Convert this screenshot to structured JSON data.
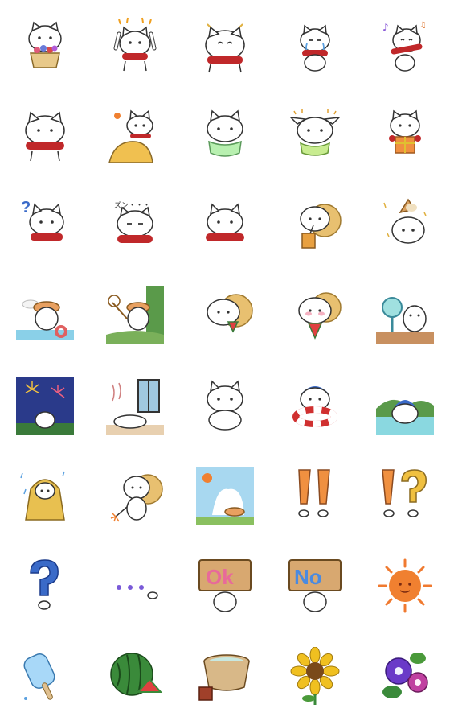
{
  "sheet": {
    "columns": 5,
    "rows": 8,
    "stickers": [
      {
        "name": "cat-flower-basket-icon"
      },
      {
        "name": "cat-cheer-icon"
      },
      {
        "name": "cat-happy-sparkle-icon"
      },
      {
        "name": "cat-tears-icon"
      },
      {
        "name": "cat-singing-icon"
      },
      {
        "name": "cat-scarf-icon"
      },
      {
        "name": "cat-on-rock-icon"
      },
      {
        "name": "cat-green-collar-icon"
      },
      {
        "name": "cat-sparkle-ears-icon"
      },
      {
        "name": "cat-gift-icon"
      },
      {
        "name": "cat-question-icon",
        "text": "?"
      },
      {
        "name": "cat-sulking-icon",
        "text": "ズン・・・"
      },
      {
        "name": "cat-scarf-2-icon"
      },
      {
        "name": "cat-drink-icon"
      },
      {
        "name": "cat-ice-cream-icon"
      },
      {
        "name": "cat-beach-hat-icon"
      },
      {
        "name": "cat-bug-net-icon"
      },
      {
        "name": "cat-watermelon-hat-icon"
      },
      {
        "name": "cat-watermelon-icon"
      },
      {
        "name": "cat-fan-icon"
      },
      {
        "name": "cat-fireworks-icon"
      },
      {
        "name": "cat-window-heat-icon"
      },
      {
        "name": "cat-sitting-icon"
      },
      {
        "name": "cat-swim-ring-icon"
      },
      {
        "name": "cat-onsen-icon"
      },
      {
        "name": "cat-raincoat-icon"
      },
      {
        "name": "cat-sparkler-icon"
      },
      {
        "name": "summer-sky-icon"
      },
      {
        "name": "exclamation-double-icon",
        "text": "!!"
      },
      {
        "name": "exclamation-question-icon",
        "text": "!?"
      },
      {
        "name": "question-mark-icon",
        "text": "?"
      },
      {
        "name": "ellipsis-dots-icon",
        "text": "・・・"
      },
      {
        "name": "ok-sign-icon",
        "text": "Ok"
      },
      {
        "name": "no-sign-icon",
        "text": "No"
      },
      {
        "name": "sun-face-icon"
      },
      {
        "name": "popsicle-icon"
      },
      {
        "name": "watermelon-icon"
      },
      {
        "name": "wooden-tub-icon"
      },
      {
        "name": "sunflower-icon"
      },
      {
        "name": "morning-glory-icon"
      }
    ]
  }
}
